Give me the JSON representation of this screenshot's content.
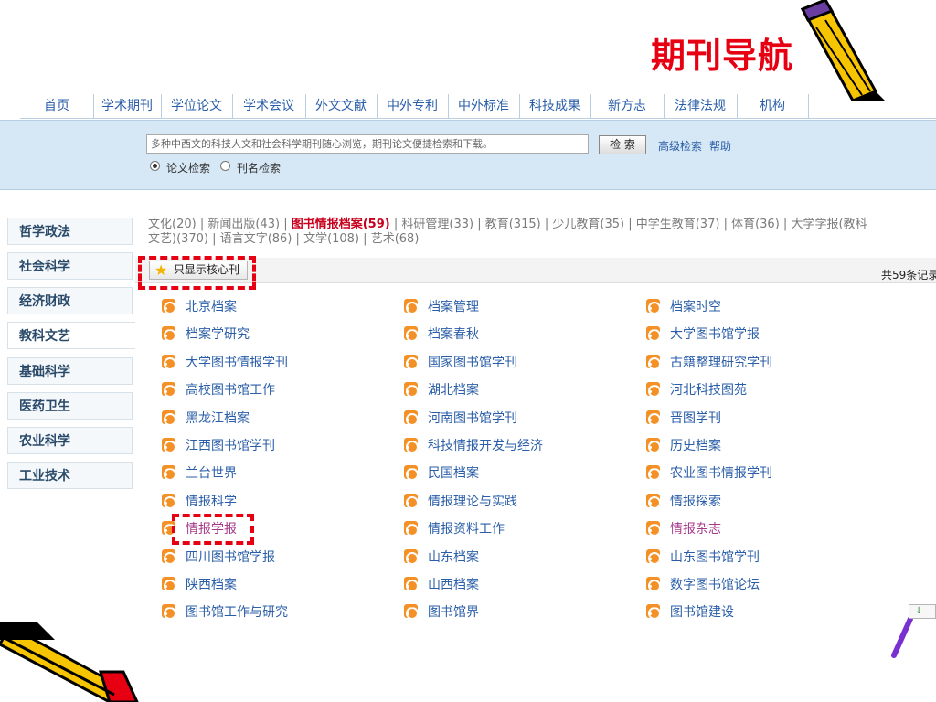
{
  "slide_title": "期刊导航",
  "nav": {
    "items": [
      "首页",
      "学术期刊",
      "学位论文",
      "学术会议",
      "外文文献",
      "中外专利",
      "中外标准",
      "科技成果",
      "新方志",
      "法律法规",
      "机构"
    ]
  },
  "search": {
    "placeholder": "多种中西文的科技人文和社会科学期刊随心浏览，期刊论文便捷检索和下载。",
    "button": "检 索",
    "advanced": "高级检索",
    "help": "帮助",
    "radio_paper": "论文检索",
    "radio_journal": "刊名检索"
  },
  "sidebar": {
    "items": [
      "哲学政法",
      "社会科学",
      "经济财政",
      "教科文艺",
      "基础科学",
      "医药卫生",
      "农业科学",
      "工业技术"
    ]
  },
  "categories": {
    "c1": "文化(20)",
    "c2": "新闻出版(43)",
    "c3": "图书情报档案(59)",
    "c4": "科研管理(33)",
    "c5": "教育(315)",
    "c6": "少儿教育(35)",
    "c7": "中学生教育(37)",
    "c8": "体育(36)",
    "c9": "大学学报(教科",
    "c10": "文艺)(370)",
    "c11": "语言文字(86)",
    "c12": "文学(108)",
    "c13": "艺术(68)",
    "sep": "|"
  },
  "filter": {
    "core_only": "只显示核心刊",
    "total": "共59条记录"
  },
  "journals": {
    "col1": [
      "北京档案",
      "档案学研究",
      "大学图书情报学刊",
      "高校图书馆工作",
      "黑龙江档案",
      "江西图书馆学刊",
      "兰台世界",
      "情报科学",
      "情报学报",
      "四川图书馆学报",
      "陕西档案",
      "图书馆工作与研究"
    ],
    "col2": [
      "档案管理",
      "档案春秋",
      "国家图书馆学刊",
      "湖北档案",
      "河南图书馆学刊",
      "科技情报开发与经济",
      "民国档案",
      "情报理论与实践",
      "情报资料工作",
      "山东档案",
      "山西档案",
      "图书馆界"
    ],
    "col3": [
      "档案时空",
      "大学图书馆学报",
      "古籍整理研究学刊",
      "河北科技图苑",
      "晋图学刊",
      "历史档案",
      "农业图书情报学刊",
      "情报探索",
      "情报杂志",
      "山东图书馆学刊",
      "数字图书馆论坛",
      "图书馆建设"
    ]
  },
  "colors": {
    "title_red": "#e60012",
    "link_blue": "#2a5ea8",
    "visited_pink": "#a63a8a",
    "rss_orange": "#f39126",
    "panel_blue": "#d6e7f5"
  }
}
